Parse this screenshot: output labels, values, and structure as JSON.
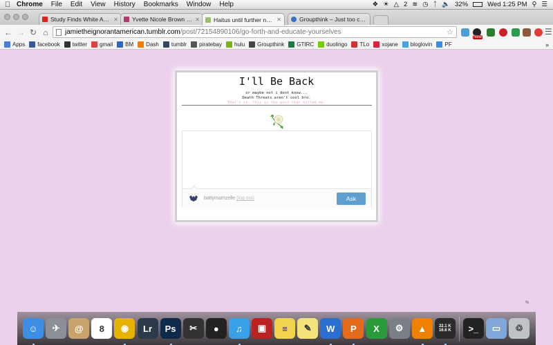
{
  "menubar": {
    "app_name": "Chrome",
    "menus": [
      "File",
      "Edit",
      "View",
      "History",
      "Bookmarks",
      "Window",
      "Help"
    ],
    "status": {
      "count": "2",
      "battery": "32%",
      "clock": "Wed 1:25 PM"
    }
  },
  "tabs": [
    {
      "title": "Study Finds White America",
      "color": "#d22"
    },
    {
      "title": "Yvette Nicole Brown Pens",
      "color": "#b03a6a"
    },
    {
      "title": "Haitus until further notice",
      "color": "#9bbf6a"
    },
    {
      "title": "Groupthink – Just too cand",
      "color": "#3a73c4"
    }
  ],
  "address_bar": {
    "host": "jamietheignorantamerican.tumblr.com",
    "path": "/post/72154890106/go-forth-and-educate-yourselves"
  },
  "bookmarks": [
    {
      "label": "Apps",
      "color": "#4c7bd9"
    },
    {
      "label": "facebook",
      "color": "#3b5998"
    },
    {
      "label": "twitter",
      "color": "#333"
    },
    {
      "label": "gmail",
      "color": "#d44"
    },
    {
      "label": "BM",
      "color": "#2a67c9"
    },
    {
      "label": "Dash",
      "color": "#f57d00"
    },
    {
      "label": "tumblr",
      "color": "#36465d"
    },
    {
      "label": "piratebay",
      "color": "#555"
    },
    {
      "label": "hulu",
      "color": "#7ab317"
    },
    {
      "label": "Groupthink",
      "color": "#444"
    },
    {
      "label": "GTIRC",
      "color": "#1d7a43"
    },
    {
      "label": "duolingo",
      "color": "#7ac70c"
    },
    {
      "label": "TLo",
      "color": "#c33"
    },
    {
      "label": "xojane",
      "color": "#d8243b"
    },
    {
      "label": "bloglovin",
      "color": "#4aa3df"
    },
    {
      "label": "PF",
      "color": "#3d8de0"
    }
  ],
  "page": {
    "title": "I'll Be Back",
    "desc_line1": "or maybe not i dont know...",
    "desc_line2": "Death Threats aren't cool bro.",
    "desc_line3": "That's it. This is the post that killed me.",
    "ask": {
      "username": "battymamzelle",
      "logout": "(log out)",
      "button": "Ask"
    },
    "corner_mark": "%"
  },
  "dock": {
    "apps": [
      {
        "name": "finder",
        "color": "#3e8ee6",
        "glyph": "☺"
      },
      {
        "name": "launchpad",
        "color": "#8b8f98",
        "glyph": "✈"
      },
      {
        "name": "contacts",
        "color": "#c9a46a",
        "glyph": "@"
      },
      {
        "name": "calendar",
        "color": "#ffffff",
        "glyph": "8"
      },
      {
        "name": "chrome",
        "color": "#e6b300",
        "glyph": "◉"
      },
      {
        "name": "lightroom",
        "color": "#2c3b4a",
        "glyph": "Lr"
      },
      {
        "name": "photoshop",
        "color": "#0f2a4a",
        "glyph": "Ps"
      },
      {
        "name": "final-cut",
        "color": "#333333",
        "glyph": "✂"
      },
      {
        "name": "camera",
        "color": "#222222",
        "glyph": "●"
      },
      {
        "name": "itunes",
        "color": "#3aa0e8",
        "glyph": "♫"
      },
      {
        "name": "photo-booth",
        "color": "#b22",
        "glyph": "▣"
      },
      {
        "name": "stickies",
        "color": "#f2d34c",
        "glyph": "≡"
      },
      {
        "name": "notes",
        "color": "#f4e27a",
        "glyph": "✎"
      },
      {
        "name": "word",
        "color": "#2b6fd1",
        "glyph": "W"
      },
      {
        "name": "powerpoint",
        "color": "#e46a1c",
        "glyph": "P"
      },
      {
        "name": "excel",
        "color": "#2a9a3a",
        "glyph": "X"
      },
      {
        "name": "system-preferences",
        "color": "#7b7f87",
        "glyph": "⚙"
      },
      {
        "name": "vlc",
        "color": "#f08000",
        "glyph": "▲"
      },
      {
        "name": "utorrent",
        "color": "#5aa32a",
        "glyph": "µ"
      },
      {
        "name": "terminal",
        "color": "#222222",
        "glyph": ">_"
      },
      {
        "name": "folder",
        "color": "#7fa8d8",
        "glyph": "▭"
      },
      {
        "name": "trash",
        "color": "#bfc3c8",
        "glyph": "♲"
      }
    ],
    "net_up": "22.1 K",
    "net_down": "16.6 K"
  }
}
